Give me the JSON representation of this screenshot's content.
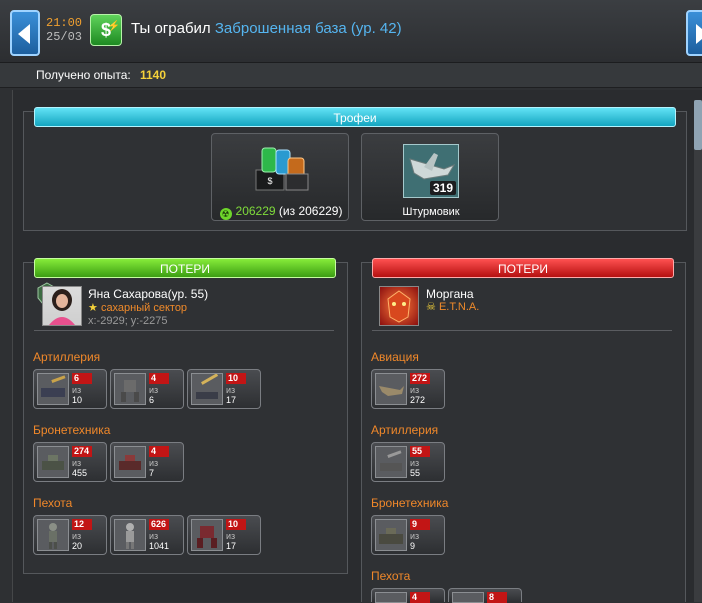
{
  "header": {
    "time": "21:00",
    "date": "25/03",
    "title_prefix": "Ты ограбил",
    "location": "Заброшенная база (ур. 42)"
  },
  "xp": {
    "label": "Получено опыта:",
    "value": "1140"
  },
  "trophies": {
    "title": "Трофеи",
    "resource": {
      "amount": "206229",
      "total": "(из 206229)"
    },
    "unit": {
      "name": "Штурмовик",
      "count": "319"
    }
  },
  "attacker": {
    "header": "ПОТЕРИ",
    "name": "Яна Сахарова(ур. 55)",
    "sector": "сахарный сектор",
    "coords": "x:-2929; y:-2275",
    "categories": [
      {
        "label": "Артиллерия",
        "units": [
          {
            "lost": "6",
            "of": "из",
            "total": "10"
          },
          {
            "lost": "4",
            "of": "из",
            "total": "6"
          },
          {
            "lost": "10",
            "of": "из",
            "total": "17"
          }
        ]
      },
      {
        "label": "Бронетехника",
        "units": [
          {
            "lost": "274",
            "of": "из",
            "total": "455"
          },
          {
            "lost": "4",
            "of": "из",
            "total": "7"
          }
        ]
      },
      {
        "label": "Пехота",
        "units": [
          {
            "lost": "12",
            "of": "из",
            "total": "20"
          },
          {
            "lost": "626",
            "of": "из",
            "total": "1041"
          },
          {
            "lost": "10",
            "of": "из",
            "total": "17"
          }
        ]
      }
    ]
  },
  "defender": {
    "header": "ПОТЕРИ",
    "name": "Моргана",
    "clan": "E.T.N.A.",
    "categories": [
      {
        "label": "Авиация",
        "units": [
          {
            "lost": "272",
            "of": "из",
            "total": "272"
          }
        ]
      },
      {
        "label": "Артиллерия",
        "units": [
          {
            "lost": "55",
            "of": "из",
            "total": "55"
          }
        ]
      },
      {
        "label": "Бронетехника",
        "units": [
          {
            "lost": "9",
            "of": "из",
            "total": "9"
          }
        ]
      },
      {
        "label": "Пехота",
        "units": [
          {
            "lost": "4"
          },
          {
            "lost": "8"
          }
        ]
      }
    ]
  }
}
